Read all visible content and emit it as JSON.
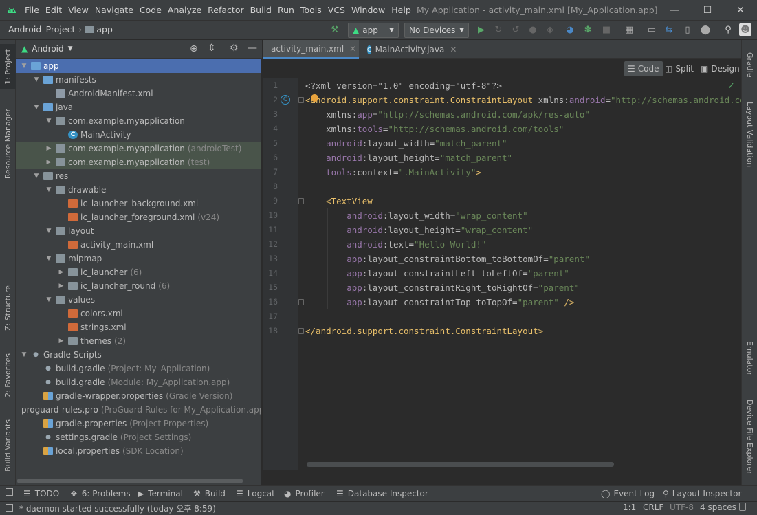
{
  "menu": [
    "File",
    "Edit",
    "View",
    "Navigate",
    "Code",
    "Analyze",
    "Refactor",
    "Build",
    "Run",
    "Tools",
    "VCS",
    "Window",
    "Help"
  ],
  "window_title": "My Application - activity_main.xml [My_Application.app]",
  "breadcrumb": {
    "project": "Android_Project",
    "module": "app"
  },
  "toolbar": {
    "run_config": "app",
    "device": "No Devices"
  },
  "left_tabs": [
    "1: Project",
    "Resource Manager",
    "Z: Structure",
    "2: Favorites",
    "Build Variants"
  ],
  "right_tabs": [
    "Gradle",
    "Layout Validation",
    "Emulator",
    "Device File Explorer"
  ],
  "project_panel": {
    "view": "Android"
  },
  "tree": [
    {
      "label": "app",
      "hint": "",
      "level": 0,
      "arrow": "down",
      "icon": "folder-blue",
      "state": "selected"
    },
    {
      "label": "manifests",
      "hint": "",
      "level": 1,
      "arrow": "down",
      "icon": "folder-blue"
    },
    {
      "label": "AndroidManifest.xml",
      "hint": "",
      "level": 2,
      "arrow": "",
      "icon": "manifest"
    },
    {
      "label": "java",
      "hint": "",
      "level": 1,
      "arrow": "down",
      "icon": "folder-blue"
    },
    {
      "label": "com.example.myapplication",
      "hint": "",
      "level": 2,
      "arrow": "down",
      "icon": "folder"
    },
    {
      "label": "MainActivity",
      "hint": "",
      "level": 3,
      "arrow": "",
      "icon": "class"
    },
    {
      "label": "com.example.myapplication",
      "hint": "(androidTest)",
      "level": 2,
      "arrow": "right",
      "icon": "folder",
      "state": "test"
    },
    {
      "label": "com.example.myapplication",
      "hint": "(test)",
      "level": 2,
      "arrow": "right",
      "icon": "folder",
      "state": "test"
    },
    {
      "label": "res",
      "hint": "",
      "level": 1,
      "arrow": "down",
      "icon": "folder"
    },
    {
      "label": "drawable",
      "hint": "",
      "level": 2,
      "arrow": "down",
      "icon": "folder"
    },
    {
      "label": "ic_launcher_background.xml",
      "hint": "",
      "level": 3,
      "arrow": "",
      "icon": "xml"
    },
    {
      "label": "ic_launcher_foreground.xml",
      "hint": "(v24)",
      "level": 3,
      "arrow": "",
      "icon": "xml"
    },
    {
      "label": "layout",
      "hint": "",
      "level": 2,
      "arrow": "down",
      "icon": "folder"
    },
    {
      "label": "activity_main.xml",
      "hint": "",
      "level": 3,
      "arrow": "",
      "icon": "xml"
    },
    {
      "label": "mipmap",
      "hint": "",
      "level": 2,
      "arrow": "down",
      "icon": "folder"
    },
    {
      "label": "ic_launcher",
      "hint": "(6)",
      "level": 3,
      "arrow": "right",
      "icon": "folder"
    },
    {
      "label": "ic_launcher_round",
      "hint": "(6)",
      "level": 3,
      "arrow": "right",
      "icon": "folder"
    },
    {
      "label": "values",
      "hint": "",
      "level": 2,
      "arrow": "down",
      "icon": "folder"
    },
    {
      "label": "colors.xml",
      "hint": "",
      "level": 3,
      "arrow": "",
      "icon": "xml"
    },
    {
      "label": "strings.xml",
      "hint": "",
      "level": 3,
      "arrow": "",
      "icon": "xml"
    },
    {
      "label": "themes",
      "hint": "(2)",
      "level": 3,
      "arrow": "right",
      "icon": "folder"
    },
    {
      "label": "Gradle Scripts",
      "hint": "",
      "level": 0,
      "arrow": "down",
      "icon": "gradle"
    },
    {
      "label": "build.gradle",
      "hint": "(Project: My_Application)",
      "level": 1,
      "arrow": "",
      "icon": "gradle"
    },
    {
      "label": "build.gradle",
      "hint": "(Module: My_Application.app)",
      "level": 1,
      "arrow": "",
      "icon": "gradle"
    },
    {
      "label": "gradle-wrapper.properties",
      "hint": "(Gradle Version)",
      "level": 1,
      "arrow": "",
      "icon": "props"
    },
    {
      "label": "proguard-rules.pro",
      "hint": "(ProGuard Rules for My_Application.app)",
      "level": 1,
      "arrow": "",
      "icon": "props"
    },
    {
      "label": "gradle.properties",
      "hint": "(Project Properties)",
      "level": 1,
      "arrow": "",
      "icon": "props"
    },
    {
      "label": "settings.gradle",
      "hint": "(Project Settings)",
      "level": 1,
      "arrow": "",
      "icon": "gradle"
    },
    {
      "label": "local.properties",
      "hint": "(SDK Location)",
      "level": 1,
      "arrow": "",
      "icon": "props"
    }
  ],
  "editor_tabs": [
    {
      "label": "activity_main.xml",
      "active": true
    },
    {
      "label": "MainActivity.java",
      "active": false
    }
  ],
  "view_modes": [
    "Code",
    "Split",
    "Design"
  ],
  "code_lines": [
    [
      [
        "<?xml version=\"1.0\" encoding=\"utf-8\"?>",
        "n"
      ]
    ],
    [
      [
        "<android.support.constraint.ConstraintLayout ",
        "t"
      ],
      [
        "xmlns:",
        "n"
      ],
      [
        "android",
        "a"
      ],
      [
        "=",
        "n"
      ],
      [
        "\"http://schemas.android.com/apk/res/android\"",
        "v"
      ]
    ],
    [
      [
        "    xmlns:",
        "n"
      ],
      [
        "app",
        "a"
      ],
      [
        "=",
        "n"
      ],
      [
        "\"http://schemas.android.com/apk/res-auto\"",
        "v"
      ]
    ],
    [
      [
        "    xmlns:",
        "n"
      ],
      [
        "tools",
        "a"
      ],
      [
        "=",
        "n"
      ],
      [
        "\"http://schemas.android.com/tools\"",
        "v"
      ]
    ],
    [
      [
        "    android",
        "a"
      ],
      [
        ":layout_width=",
        "n"
      ],
      [
        "\"match_parent\"",
        "v"
      ]
    ],
    [
      [
        "    android",
        "a"
      ],
      [
        ":layout_height=",
        "n"
      ],
      [
        "\"match_parent\"",
        "v"
      ]
    ],
    [
      [
        "    tools",
        "a"
      ],
      [
        ":context=",
        "n"
      ],
      [
        "\".MainActivity\"",
        "v"
      ],
      [
        ">",
        "t"
      ]
    ],
    [
      [
        "",
        "n"
      ]
    ],
    [
      [
        "    <TextView",
        "t"
      ]
    ],
    [
      [
        "        android",
        "a"
      ],
      [
        ":layout_width=",
        "n"
      ],
      [
        "\"wrap_content\"",
        "v"
      ]
    ],
    [
      [
        "        android",
        "a"
      ],
      [
        ":layout_height=",
        "n"
      ],
      [
        "\"wrap_content\"",
        "v"
      ]
    ],
    [
      [
        "        android",
        "a"
      ],
      [
        ":text=",
        "n"
      ],
      [
        "\"Hello World!\"",
        "v"
      ]
    ],
    [
      [
        "        app",
        "a"
      ],
      [
        ":layout_constraintBottom_toBottomOf=",
        "n"
      ],
      [
        "\"parent\"",
        "v"
      ]
    ],
    [
      [
        "        app",
        "a"
      ],
      [
        ":layout_constraintLeft_toLeftOf=",
        "n"
      ],
      [
        "\"parent\"",
        "v"
      ]
    ],
    [
      [
        "        app",
        "a"
      ],
      [
        ":layout_constraintRight_toRightOf=",
        "n"
      ],
      [
        "\"parent\"",
        "v"
      ]
    ],
    [
      [
        "        app",
        "a"
      ],
      [
        ":layout_constraintTop_toTopOf=",
        "n"
      ],
      [
        "\"parent\"",
        "v"
      ],
      [
        " />",
        "t"
      ]
    ],
    [
      [
        "",
        "n"
      ]
    ],
    [
      [
        "</android.support.constraint.ConstraintLayout>",
        "t"
      ]
    ]
  ],
  "bottom_tools": [
    "TODO",
    "6: Problems",
    "Terminal",
    "Build",
    "Logcat",
    "Profiler",
    "Database Inspector"
  ],
  "bottom_right_tools": [
    "Event Log",
    "Layout Inspector"
  ],
  "status": {
    "message": "* daemon started successfully (today 오후 8:59)",
    "position": "1:1",
    "line_sep": "CRLF",
    "encoding": "UTF-8",
    "indent": "4 spaces"
  }
}
